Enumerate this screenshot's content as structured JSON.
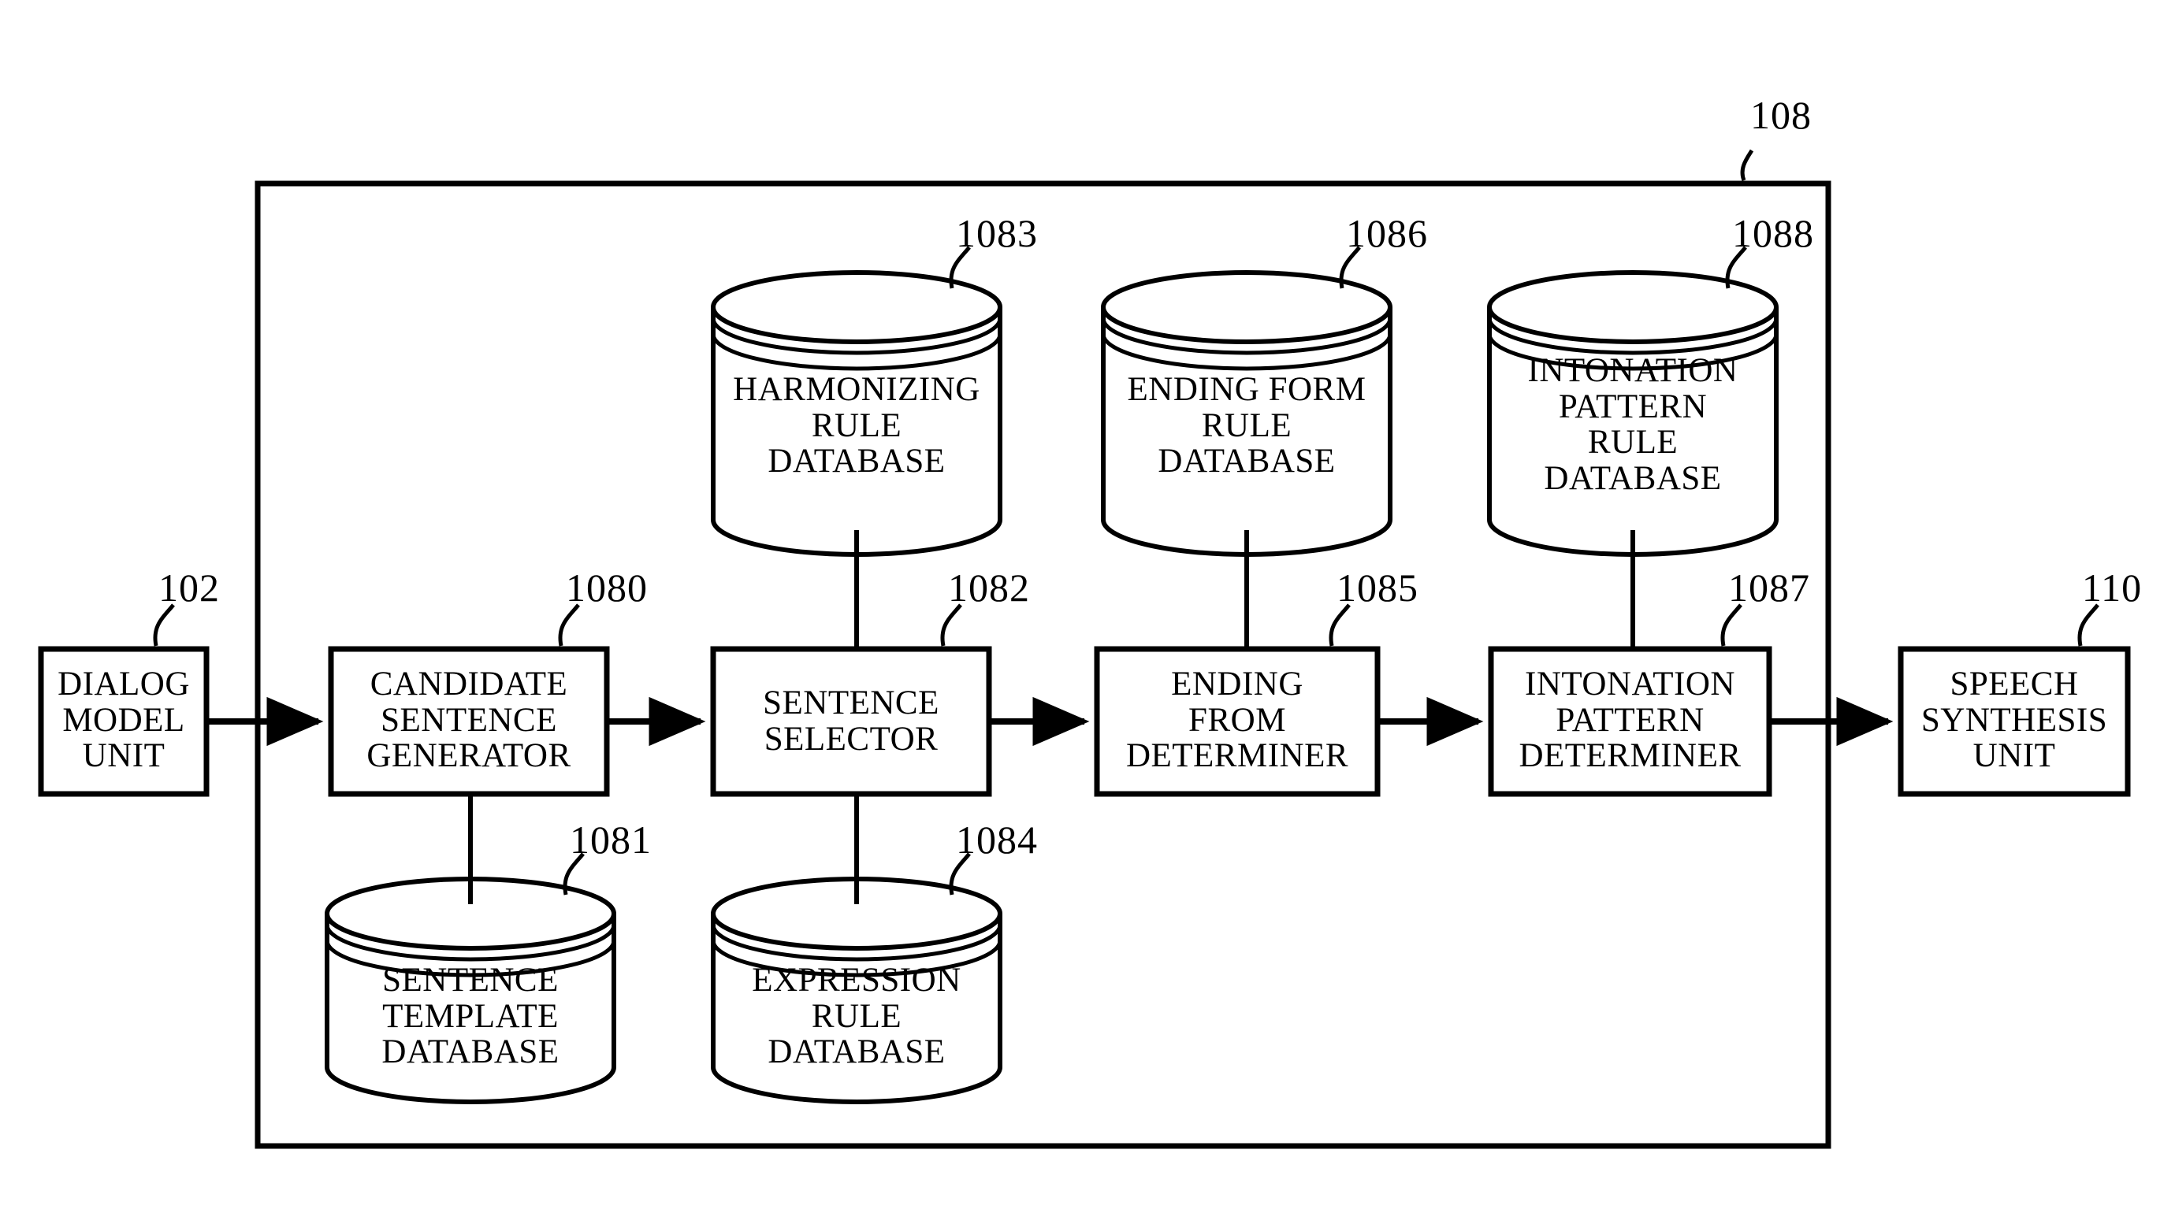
{
  "figure": {
    "type": "patent-block-diagram",
    "container": {
      "ref": "108"
    }
  },
  "external_blocks": [
    {
      "id": "dialog-model-unit",
      "label": "DIALOG\nMODEL\nUNIT",
      "ref": "102"
    },
    {
      "id": "speech-synthesis-unit",
      "label": "SPEECH\nSYNTHESIS\nUNIT",
      "ref": "110"
    }
  ],
  "process_blocks": [
    {
      "id": "candidate-sentence-generator",
      "label": "CANDIDATE\nSENTENCE\nGENERATOR",
      "ref": "1080"
    },
    {
      "id": "sentence-selector",
      "label": "SENTENCE\nSELECTOR",
      "ref": "1082"
    },
    {
      "id": "ending-from-determiner",
      "label": "ENDING\nFROM\nDETERMINER",
      "ref": "1085"
    },
    {
      "id": "intonation-pattern-determiner",
      "label": "INTONATION\nPATTERN\nDETERMINER",
      "ref": "1087"
    }
  ],
  "databases_top": [
    {
      "id": "harmonizing-rule-database",
      "label": "HARMONIZING\nRULE\nDATABASE",
      "ref": "1083"
    },
    {
      "id": "ending-form-rule-database",
      "label": "ENDING FORM\nRULE\nDATABASE",
      "ref": "1086"
    },
    {
      "id": "intonation-pattern-rule-database",
      "label": "INTONATION\nPATTERN\nRULE\nDATABASE",
      "ref": "1088"
    }
  ],
  "databases_bottom": [
    {
      "id": "sentence-template-database",
      "label": "SENTENCE\nTEMPLATE\nDATABASE",
      "ref": "1081"
    },
    {
      "id": "expression-rule-database",
      "label": "EXPRESSION\nRULE\nDATABASE",
      "ref": "1084"
    }
  ],
  "colors": {
    "line": "#000000",
    "background": "#ffffff"
  }
}
